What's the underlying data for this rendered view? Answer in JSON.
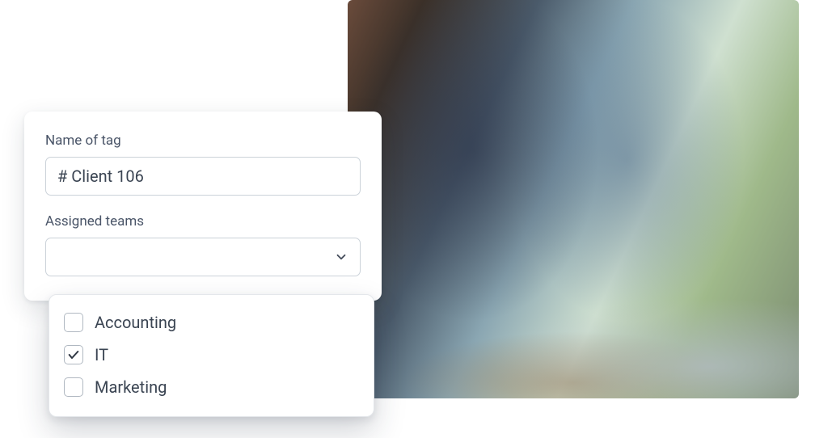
{
  "form": {
    "tag_name_label": "Name of tag",
    "tag_name_value": "# Client 106",
    "assigned_teams_label": "Assigned teams",
    "teams": [
      {
        "label": "Accounting",
        "checked": false
      },
      {
        "label": "IT",
        "checked": true
      },
      {
        "label": "Marketing",
        "checked": false
      }
    ]
  }
}
